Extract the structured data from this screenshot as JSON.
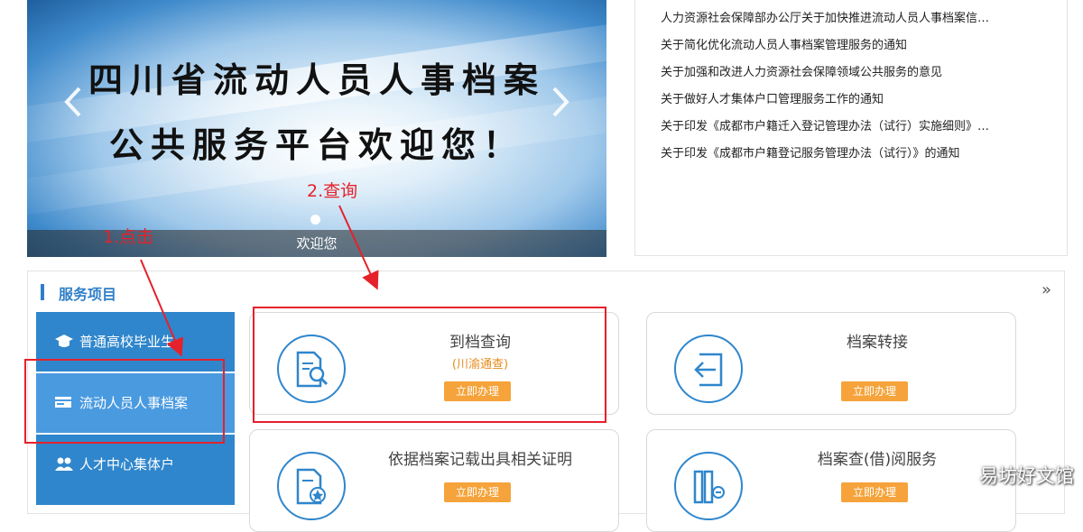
{
  "banner": {
    "line1": "四川省流动人员人事档案",
    "line2": "公共服务平台欢迎您！",
    "caption": "欢迎您",
    "prev_icon": "chevron-left-icon",
    "next_icon": "chevron-right-icon"
  },
  "news": {
    "items": [
      "人力资源社会保障部办公厅关于加快推进流动人员人事档案信…",
      "关于简化优化流动人员人事档案管理服务的通知",
      "关于加强和改进人力资源社会保障领域公共服务的意见",
      "关于做好人才集体户口管理服务工作的通知",
      "关于印发《成都市户籍迁入登记管理办法（试行）实施细则》…",
      "关于印发《成都市户籍登记服务管理办法（试行）》的通知"
    ]
  },
  "services": {
    "title": "服务项目",
    "more": "»",
    "side_nav": [
      {
        "label": "普通高校毕业生",
        "icon": "graduation-cap-icon"
      },
      {
        "label": "流动人员人事档案",
        "icon": "card-icon"
      },
      {
        "label": "人才中心集体户",
        "icon": "users-icon"
      }
    ],
    "cards": [
      {
        "name": "到档查询",
        "sub": "(川渝通查)",
        "button": "立即办理",
        "icon": "document-search-icon"
      },
      {
        "name": "档案转接",
        "sub": "",
        "button": "立即办理",
        "icon": "transfer-in-icon"
      },
      {
        "name": "依据档案记载出具相关证明",
        "sub": "",
        "button": "立即办理",
        "icon": "certificate-icon"
      },
      {
        "name": "档案查(借)阅服务",
        "sub": "",
        "button": "立即办理",
        "icon": "archive-icon"
      }
    ]
  },
  "annotations": {
    "step1": "1.点击",
    "step2": "2.查询",
    "color": "#e5212b"
  },
  "watermark": "易坊好文馆",
  "colors": {
    "accent": "#2f86cc",
    "button": "#f5a33a",
    "subtitle": "#e88a1a"
  }
}
